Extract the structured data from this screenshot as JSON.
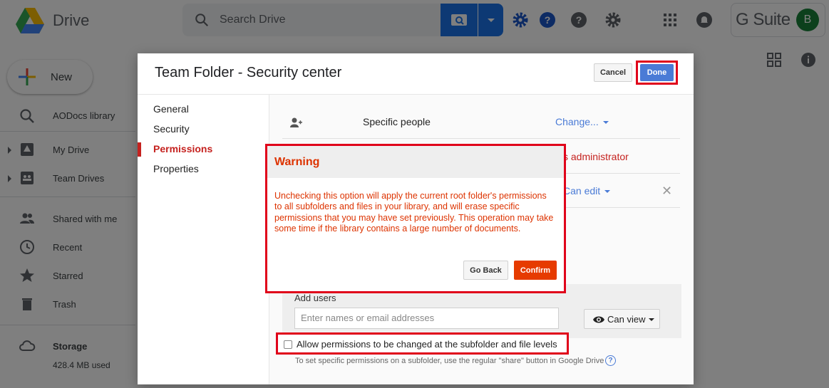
{
  "app": {
    "name": "Drive",
    "search_placeholder": "Search Drive",
    "gsuite_label": "G Suite",
    "avatar_letter": "B"
  },
  "sidebar": {
    "new_label": "New",
    "items": [
      {
        "label": "AODocs library",
        "icon": "search-icon"
      },
      {
        "label": "My Drive",
        "icon": "my-drive-icon"
      },
      {
        "label": "Team Drives",
        "icon": "team-drives-icon"
      },
      {
        "label": "Shared with me",
        "icon": "people-icon"
      },
      {
        "label": "Recent",
        "icon": "clock-icon"
      },
      {
        "label": "Starred",
        "icon": "star-icon"
      },
      {
        "label": "Trash",
        "icon": "trash-icon"
      }
    ],
    "storage_label": "Storage",
    "storage_used": "428.4 MB used"
  },
  "dialog": {
    "title": "Team Folder - Security center",
    "cancel_label": "Cancel",
    "done_label": "Done",
    "nav": [
      "General",
      "Security",
      "Permissions",
      "Properties"
    ],
    "active_nav": "Permissions",
    "rows": {
      "specific_people": "Specific people",
      "change_link": "Change...",
      "admin_fragment": "s administrator",
      "can_edit": "Can edit"
    },
    "add_users_label": "Add users",
    "add_users_placeholder": "Enter names or email addresses",
    "can_view_label": "Can view",
    "allow_label": "Allow permissions to be changed at the subfolder and file levels",
    "allow_checked": false,
    "hint": "To set specific permissions on a subfolder, use the regular \"share\" button in Google Drive"
  },
  "warning": {
    "title": "Warning",
    "message": "Unchecking this option will apply the current root folder's permissions to all subfolders and files in your library, and will erase specific permissions that you may have set previously. This operation may take some time if the library contains a large number of documents.",
    "go_back_label": "Go Back",
    "confirm_label": "Confirm"
  },
  "colors": {
    "accent_blue": "#4a7bd6",
    "warning_red": "#dd3300",
    "highlight_frame": "#e0001a",
    "confirm_bg": "#e63b00"
  }
}
